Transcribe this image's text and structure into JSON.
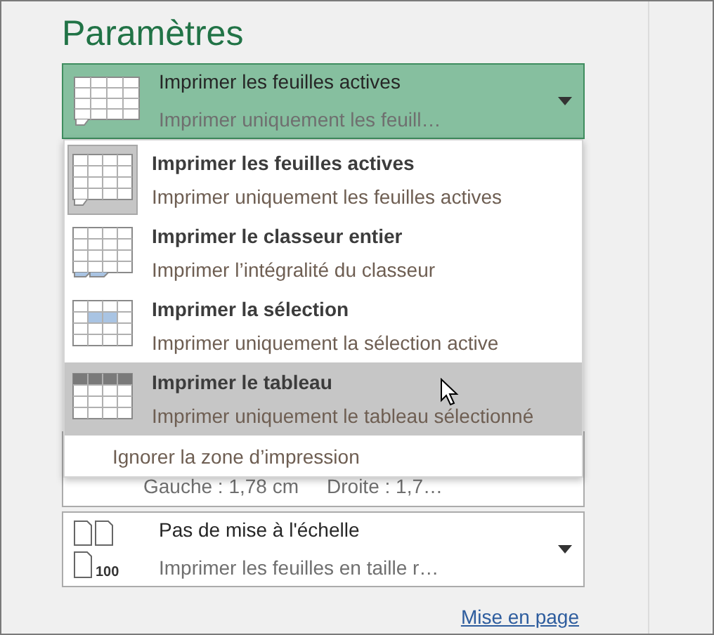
{
  "section_title": "Paramètres",
  "print_what": {
    "title": "Imprimer les feuilles actives",
    "subtitle": "Imprimer uniquement les feuill…",
    "open": true
  },
  "menu": {
    "items": [
      {
        "kind": "sheets",
        "title": "Imprimer les feuilles actives",
        "subtitle": "Imprimer uniquement les feuilles actives",
        "selected": true,
        "hovered": false
      },
      {
        "kind": "workbook",
        "title": "Imprimer le classeur entier",
        "subtitle": "Imprimer l’intégralité du classeur",
        "selected": false,
        "hovered": false
      },
      {
        "kind": "selection",
        "title": "Imprimer la sélection",
        "subtitle": "Imprimer uniquement la sélection active",
        "selected": false,
        "hovered": false
      },
      {
        "kind": "table",
        "title": "Imprimer le tableau",
        "subtitle": "Imprimer uniquement le tableau sélectionné",
        "selected": false,
        "hovered": true
      }
    ],
    "ignore_print_area": "Ignorer la zone d’impression"
  },
  "margins": {
    "left": "Gauche : 1,78 cm",
    "right": "Droite : 1,7…"
  },
  "scaling": {
    "title": "Pas de mise à l'échelle",
    "subtitle": "Imprimer les feuilles en taille r…",
    "icon_label": "100"
  },
  "page_setup_link": "Mise en page"
}
